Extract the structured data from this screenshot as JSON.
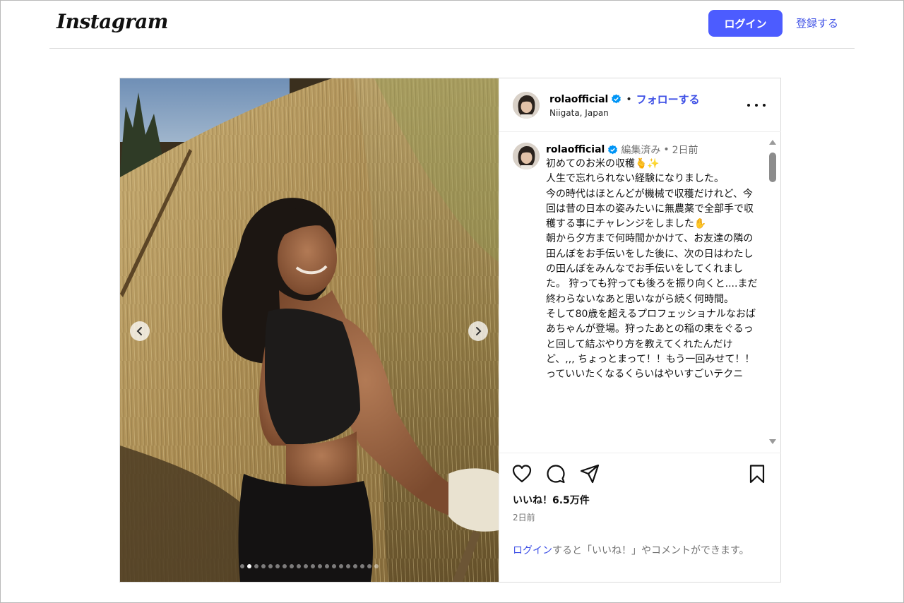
{
  "header": {
    "logo_text": "Instagram",
    "login_label": "ログイン",
    "signup_label": "登録する"
  },
  "post": {
    "username": "rolaofficial",
    "follow_label": "フォローする",
    "separator": "•",
    "location": "Niigata, Japan",
    "caption": {
      "username": "rolaofficial",
      "edited_label": "編集済み",
      "meta_separator": "•",
      "time_ago": "2日前",
      "text": "初めてのお米の収穫🫰✨\n人生で忘れられない経験になりました。\n今の時代はほとんどが機械で収穫だけれど、今回は昔の日本の姿みたいに無農薬で全部手で収穫する事にチャレンジをしました✋\n朝から夕方まで何時間かかけて、お友達の隣の田んぼをお手伝いをした後に、次の日はわたしの田んぼをみんなでお手伝いをしてくれました。 狩っても狩っても後ろを振り向くと....まだ終わらないなあと思いながら続く何時間。\nそして80歳を超えるプロフェッショナルなおばあちゃんが登場。狩ったあとの稲の束をぐるっと回して結ぶやり方を教えてくれたんだけど、,,, ちょっとまって！！もう一回みせて！！っていいたくなるくらいはやいすごいテクニ"
    },
    "likes_text": "いいね！6.5万件",
    "date_text": "2日前",
    "login_prompt": {
      "link": "ログイン",
      "rest": "すると「いいね！」やコメントができます。"
    },
    "carousel": {
      "total_slides": 20,
      "current_slide": 2
    }
  },
  "colors": {
    "accent": "#4c5cff",
    "link": "#3f51e6",
    "verified": "#0095f6",
    "muted": "#737373"
  },
  "icons": [
    "like-heart-icon",
    "comment-icon",
    "share-icon",
    "bookmark-icon",
    "verified-badge-icon",
    "more-options-icon",
    "chevron-left-icon",
    "chevron-right-icon"
  ]
}
